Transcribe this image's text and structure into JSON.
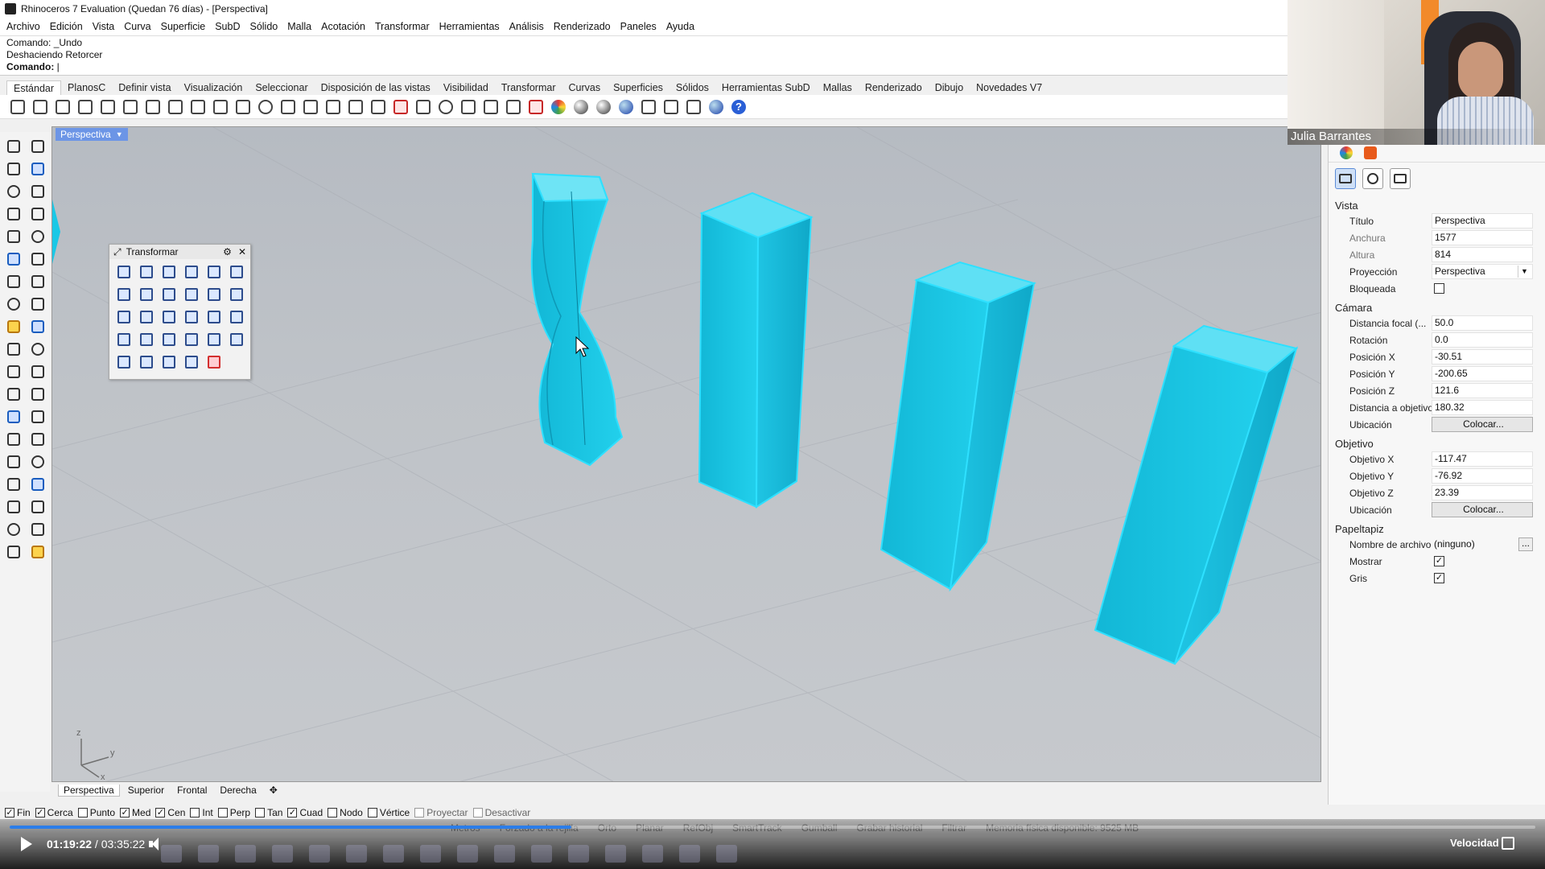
{
  "window": {
    "title": "Rhinoceros 7 Evaluation (Quedan 76 días) - [Perspectiva]"
  },
  "menu": [
    "Archivo",
    "Edición",
    "Vista",
    "Curva",
    "Superficie",
    "SubD",
    "Sólido",
    "Malla",
    "Acotación",
    "Transformar",
    "Herramientas",
    "Análisis",
    "Renderizado",
    "Paneles",
    "Ayuda"
  ],
  "command": {
    "history1": "Comando: _Undo",
    "history2": "Deshaciendo Retorcer",
    "prompt_label": "Comando:",
    "prompt_value": ""
  },
  "toolbar_tabs": [
    "Estándar",
    "PlanosC",
    "Definir vista",
    "Visualización",
    "Seleccionar",
    "Disposición de las vistas",
    "Visibilidad",
    "Transformar",
    "Curvas",
    "Superficies",
    "Sólidos",
    "Herramientas SubD",
    "Mallas",
    "Renderizado",
    "Dibujo",
    "Novedades V7"
  ],
  "toolbar_icons": [
    "new-icon",
    "open-icon",
    "save-icon",
    "print-icon",
    "import-icon",
    "cut-icon",
    "copy-icon",
    "paste-icon",
    "undo-icon",
    "pan-icon",
    "rotate-view-icon",
    "zoom-icon",
    "zoom-window-icon",
    "zoom-extents-icon",
    "zoom-selected-icon",
    "rotate-icon",
    "viewport-layout-icon",
    "car-icon",
    "camera-icon",
    "circle-plane-icon",
    "point-icon",
    "light-icon",
    "lock-icon",
    "layer-icon",
    "color-wheel-icon",
    "shaded-sphere-icon",
    "render-sphere-icon",
    "rendered-sphere-icon",
    "options-icon",
    "settings-icon",
    "grid-icon",
    "globe-icon",
    "help-icon"
  ],
  "viewport": {
    "label": "Perspectiva",
    "axis_x": "x",
    "axis_y": "y",
    "axis_z": "z",
    "object_color": "#19c8e6",
    "tabs": [
      "Perspectiva",
      "Superior",
      "Frontal",
      "Derecha"
    ],
    "add_tab": "✥"
  },
  "transform_panel": {
    "title": "Transformar",
    "icon_count": 29
  },
  "osnap": [
    {
      "label": "Fin",
      "checked": true
    },
    {
      "label": "Cerca",
      "checked": true
    },
    {
      "label": "Punto",
      "checked": false
    },
    {
      "label": "Med",
      "checked": true
    },
    {
      "label": "Cen",
      "checked": true
    },
    {
      "label": "Int",
      "checked": false
    },
    {
      "label": "Perp",
      "checked": false
    },
    {
      "label": "Tan",
      "checked": false
    },
    {
      "label": "Cuad",
      "checked": true
    },
    {
      "label": "Nodo",
      "checked": false
    },
    {
      "label": "Vértice",
      "checked": false
    },
    {
      "label": "Proyectar",
      "checked": false,
      "disabled": true
    },
    {
      "label": "Desactivar",
      "checked": false,
      "disabled": true
    }
  ],
  "statusbar": [
    "Metros",
    "Forzado a la rejilla",
    "Orto",
    "Planar",
    "RefObj",
    "SmartTrack",
    "Gumball",
    "Grabar historial",
    "Filtrar",
    "Memoria física disponible: 9525 MB"
  ],
  "properties": {
    "vista": {
      "header": "Vista",
      "titulo_label": "Título",
      "titulo": "Perspectiva",
      "anchura_label": "Anchura",
      "anchura": "1577",
      "altura_label": "Altura",
      "altura": "814",
      "proyeccion_label": "Proyección",
      "proyeccion": "Perspectiva",
      "bloqueada_label": "Bloqueada",
      "bloqueada": false
    },
    "camara": {
      "header": "Cámara",
      "focal_label": "Distancia focal (...",
      "focal": "50.0",
      "rotacion_label": "Rotación",
      "rotacion": "0.0",
      "posx_label": "Posición X",
      "posx": "-30.51",
      "posy_label": "Posición Y",
      "posy": "-200.65",
      "posz_label": "Posición Z",
      "posz": "121.6",
      "dist_label": "Distancia a objetivo",
      "dist": "180.32",
      "ubic_label": "Ubicación",
      "ubic_btn": "Colocar..."
    },
    "objetivo": {
      "header": "Objetivo",
      "ox_label": "Objetivo X",
      "ox": "-117.47",
      "oy_label": "Objetivo Y",
      "oy": "-76.92",
      "oz_label": "Objetivo Z",
      "oz": "23.39",
      "ubic_label": "Ubicación",
      "ubic_btn": "Colocar..."
    },
    "papeltapiz": {
      "header": "Papeltapiz",
      "archivo_label": "Nombre de archivo",
      "archivo": "(ninguno)",
      "archivo_btn": "...",
      "mostrar_label": "Mostrar",
      "mostrar": true,
      "gris_label": "Gris",
      "gris": true
    }
  },
  "webcam": {
    "name": "Julia Barrantes"
  },
  "player": {
    "current_time": "01:19:22",
    "separator": " / ",
    "total_time": "03:35:22",
    "progress": 0.368,
    "speed_label": "Velocidad",
    "progress_color": "#2b7de9"
  }
}
